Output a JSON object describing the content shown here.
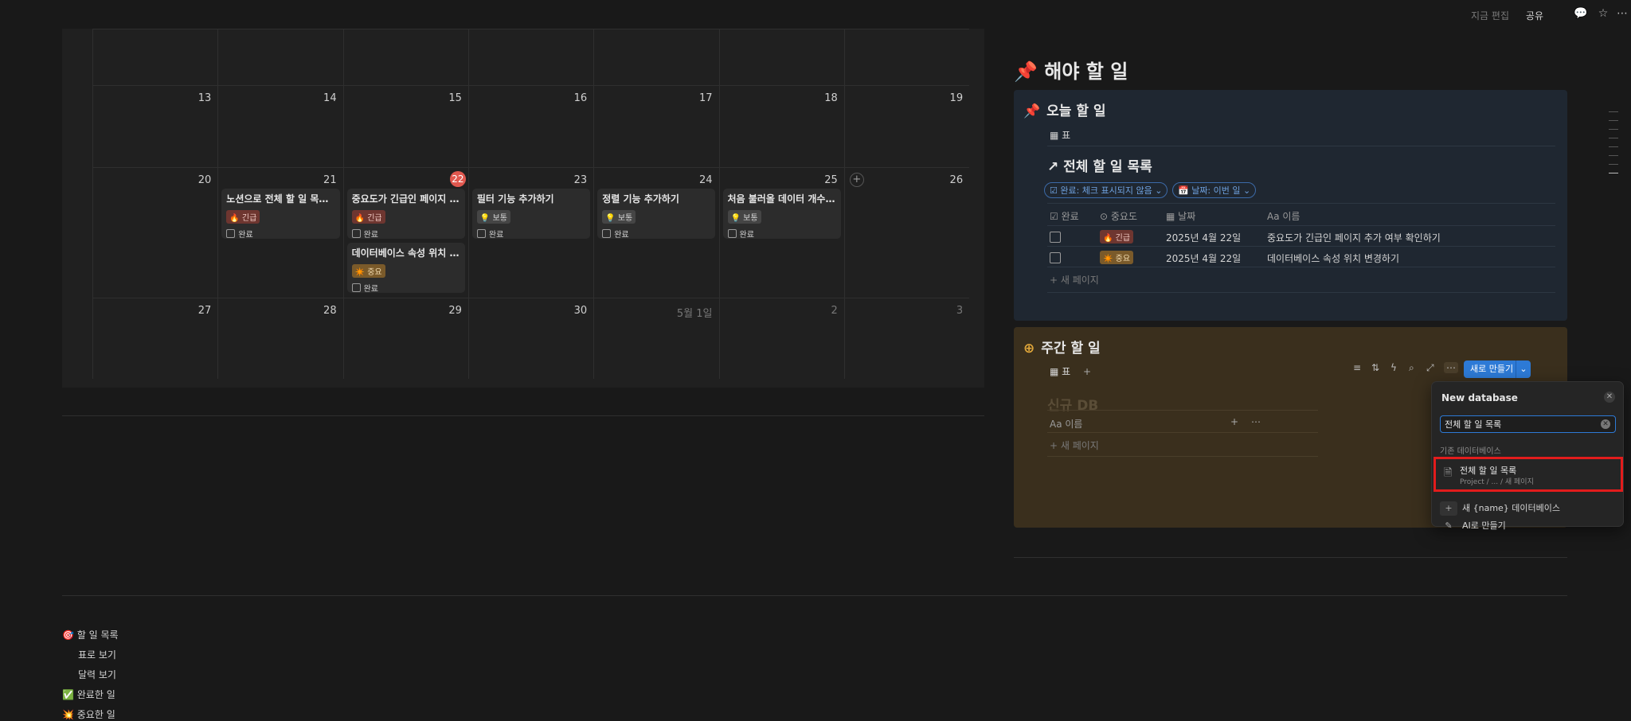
{
  "topbar": {
    "edited": "지금 편집",
    "share": "공유",
    "icons": [
      "comment-icon",
      "star-icon",
      "more-icon"
    ]
  },
  "calendar": {
    "rows": [
      {
        "days": [
          "",
          "",
          "",
          "",
          "",
          "",
          ""
        ]
      },
      {
        "days": [
          "13",
          "14",
          "15",
          "16",
          "17",
          "18",
          "19"
        ]
      },
      {
        "days": [
          "20",
          "21",
          "22",
          "23",
          "24",
          "25",
          "26"
        ],
        "today_index": 2
      },
      {
        "days": [
          "27",
          "28",
          "29",
          "30",
          "5월 1일",
          "2",
          "3"
        ],
        "dim_from": 4
      }
    ],
    "events": [
      {
        "col": 1,
        "title": "노션으로 전체 할 일 목록 만...",
        "tag": "🔥 긴급",
        "tag_type": "urgent",
        "done": "완료"
      },
      {
        "col": 2,
        "title": "중요도가 긴급인 페이지 추...",
        "tag": "🔥 긴급",
        "tag_type": "urgent",
        "done": "완료"
      },
      {
        "col": 3,
        "title": "필터 기능 추가하기",
        "tag": "💡 보통",
        "tag_type": "normal",
        "done": "완료"
      },
      {
        "col": 4,
        "title": "정렬 기능 추가하기",
        "tag": "💡 보통",
        "tag_type": "normal",
        "done": "완료"
      },
      {
        "col": 5,
        "title": "처음 불러올 데이터 개수 지...",
        "tag": "💡 보통",
        "tag_type": "normal",
        "done": "완료"
      },
      {
        "col": 2,
        "title": "데이터베이스 속성 위치 변...",
        "tag": "✴️ 중요",
        "tag_type": "important",
        "done": "완료",
        "second": true
      }
    ]
  },
  "todo": {
    "title": "해야 할 일",
    "title_icon": "📌",
    "today": {
      "title": "오늘 할 일",
      "view_tab": "표",
      "linked_title": "↗ 전체 할 일 목록",
      "filters": [
        "☑ 완료: 체크 표시되지 않음 ⌄",
        "📅 날짜: 이번 일 ⌄"
      ],
      "columns": [
        "완료",
        "중요도",
        "날짜",
        "Aa 이름"
      ],
      "rows": [
        {
          "importance": "🔥 긴급",
          "type": "urgent",
          "date": "2025년 4월 22일",
          "name": "중요도가 긴급인 페이지 추가 여부 확인하기"
        },
        {
          "importance": "✴️ 중요",
          "type": "important",
          "date": "2025년 4월 22일",
          "name": "데이터베이스 속성 위치 변경하기"
        }
      ],
      "new_page": "+ 새 페이지"
    },
    "weekly": {
      "title": "주간 할 일",
      "view_tab": "표",
      "ghost_title": "신규 DB",
      "column": "Aa 이름",
      "new_page": "+ 새 페이지",
      "new_button": "새로 만들기"
    }
  },
  "popover": {
    "title": "New database",
    "search_value": "전체 할 일 목록",
    "section": "기존 데이터베이스",
    "result": {
      "title": "전체 할 일 목록",
      "path": "Project / ... / 새 페이지"
    },
    "items": [
      {
        "icon": "+",
        "label": "새 {name} 데이터베이스"
      },
      {
        "icon": "✎",
        "label": "AI로 만들기"
      }
    ]
  },
  "bottom_list": [
    {
      "label": "🎯 할 일 목록",
      "indent": 0
    },
    {
      "label": "표로 보기",
      "indent": 1
    },
    {
      "label": "달력 보기",
      "indent": 1
    },
    {
      "label": "✅ 완료한 일",
      "indent": 0
    },
    {
      "label": "💥 중요한 일",
      "indent": 0
    }
  ]
}
